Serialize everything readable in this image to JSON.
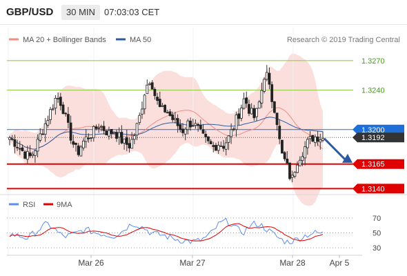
{
  "header": {
    "symbol": "GBP/USD",
    "timeframe": "30 MIN",
    "time": "07:03:03 CET"
  },
  "price_panel": {
    "legend": [
      {
        "label": "MA 20 + Bollinger Bands",
        "color": "#f28b82"
      },
      {
        "label": "MA 50",
        "color": "#2d5a9e"
      }
    ],
    "copyright": "Research © 2019 Trading Central",
    "levels": [
      {
        "label": "1.3270",
        "value": 1.327,
        "kind": "resistance",
        "color": "#8cc63f"
      },
      {
        "label": "1.3240",
        "value": 1.324,
        "kind": "resistance",
        "color": "#8cc63f"
      },
      {
        "label": "1.3200",
        "value": 1.32,
        "kind": "pivot",
        "color": "#1e6fd9"
      },
      {
        "label": "1.3192",
        "value": 1.3192,
        "kind": "last",
        "color": "#333333"
      },
      {
        "label": "1.3165",
        "value": 1.3165,
        "kind": "support",
        "color": "#e00000"
      },
      {
        "label": "1.3140",
        "value": 1.314,
        "kind": "support",
        "color": "#e00000"
      }
    ],
    "forecast_arrow": {
      "from_value": 1.3191,
      "to_value": 1.3167,
      "color": "#2d5a9e"
    }
  },
  "rsi_panel": {
    "legend": [
      {
        "label": "RSI",
        "color": "#5b8def"
      },
      {
        "label": "9MA",
        "color": "#e00000"
      }
    ],
    "ticks": [
      "70",
      "50",
      "30"
    ]
  },
  "x_axis": {
    "labels": [
      "Mar 26",
      "Mar 27",
      "Mar 28",
      "Apr 5"
    ]
  },
  "chart_data": {
    "type": "candlestick",
    "panels": [
      "price",
      "rsi"
    ],
    "price_range": [
      1.3134,
      1.3286
    ],
    "rsi_range": [
      20,
      80
    ],
    "horizontal_levels": [
      1.327,
      1.324,
      1.32,
      1.3192,
      1.3165,
      1.314
    ],
    "price_anchors": [
      1.3192,
      1.3187,
      1.3181,
      1.3175,
      1.3172,
      1.3182,
      1.3196,
      1.3208,
      1.3221,
      1.3234,
      1.3226,
      1.3206,
      1.3188,
      1.3176,
      1.3187,
      1.3193,
      1.3197,
      1.3205,
      1.3201,
      1.3196,
      1.3199,
      1.3192,
      1.3186,
      1.3184,
      1.3196,
      1.3215,
      1.3242,
      1.3253,
      1.3231,
      1.3219,
      1.322,
      1.3212,
      1.3206,
      1.3198,
      1.3206,
      1.3207,
      1.3201,
      1.3192,
      1.3186,
      1.3182,
      1.3186,
      1.3184,
      1.3192,
      1.3204,
      1.3218,
      1.3232,
      1.3219,
      1.3211,
      1.3231,
      1.3262,
      1.3235,
      1.3218,
      1.3176,
      1.3165,
      1.3147,
      1.3168,
      1.3177,
      1.3186,
      1.3192,
      1.3193,
      1.3191
    ],
    "rsi_anchors": [
      48,
      47,
      45,
      43,
      50,
      56,
      62,
      58,
      49,
      45,
      47,
      50,
      54,
      53,
      50,
      49,
      47,
      46,
      50,
      57,
      63,
      60,
      56,
      50,
      48,
      47,
      44,
      42,
      40,
      39,
      38,
      40,
      44,
      51,
      61,
      66,
      63,
      55,
      50,
      58,
      63,
      60,
      54,
      48,
      42,
      38,
      39,
      42,
      46,
      49,
      50,
      49
    ]
  }
}
